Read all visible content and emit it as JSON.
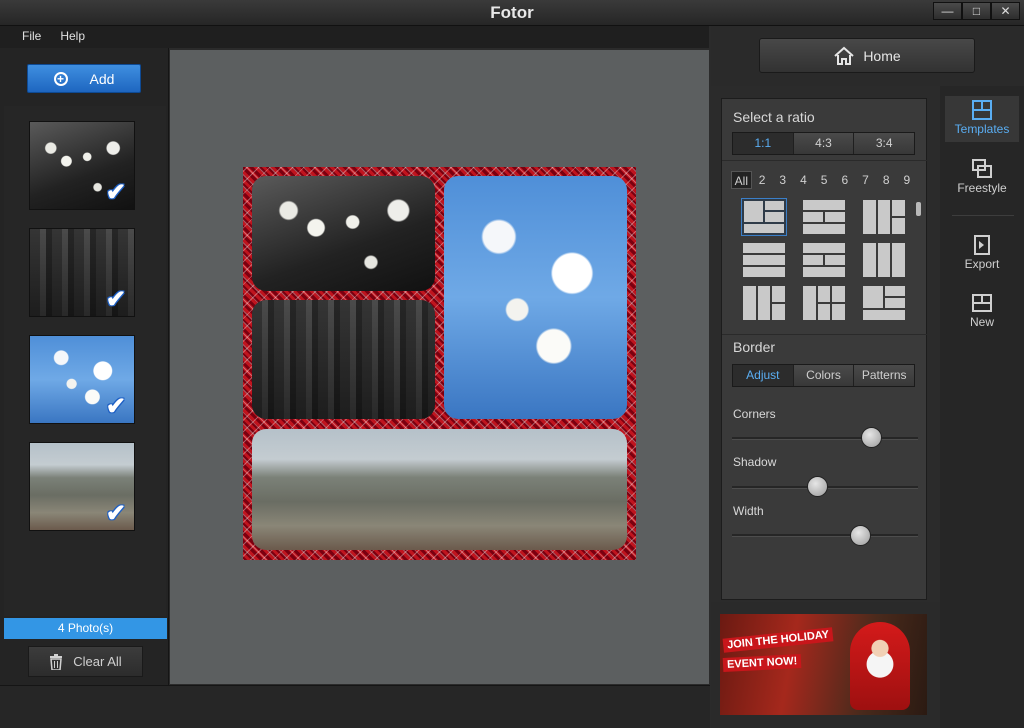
{
  "window": {
    "title": "Fotor",
    "controls": [
      "—",
      "□",
      "✕"
    ]
  },
  "menu": {
    "items": [
      "File",
      "Help"
    ]
  },
  "left": {
    "add_label": "Add",
    "photo_count": "4 Photo(s)",
    "clear_label": "Clear All"
  },
  "home": {
    "label": "Home"
  },
  "templates_panel": {
    "ratio_title": "Select a ratio",
    "ratios": [
      "1:1",
      "4:3",
      "3:4"
    ],
    "selected_ratio": "1:1",
    "counts": [
      "All",
      "2",
      "3",
      "4",
      "5",
      "6",
      "7",
      "8",
      "9"
    ],
    "selected_count": "All",
    "border_title": "Border",
    "border_tabs": [
      "Adjust",
      "Colors",
      "Patterns"
    ],
    "selected_border_tab": "Adjust",
    "sliders": [
      {
        "label": "Corners",
        "value": 0.75
      },
      {
        "label": "Shadow",
        "value": 0.46
      },
      {
        "label": "Width",
        "value": 0.69
      }
    ]
  },
  "tools": [
    {
      "label": "Templates",
      "icon": "templates-icon",
      "active": true
    },
    {
      "label": "Freestyle",
      "icon": "freestyle-icon",
      "active": false
    },
    {
      "label": "Export",
      "icon": "export-icon",
      "active": false
    },
    {
      "label": "New",
      "icon": "new-icon",
      "active": false
    }
  ],
  "ad": {
    "line1": "JOIN THE HOLIDAY",
    "line2": "EVENT NOW!"
  },
  "colors": {
    "accent": "#3396e5",
    "border_pattern": "#a0101a"
  }
}
